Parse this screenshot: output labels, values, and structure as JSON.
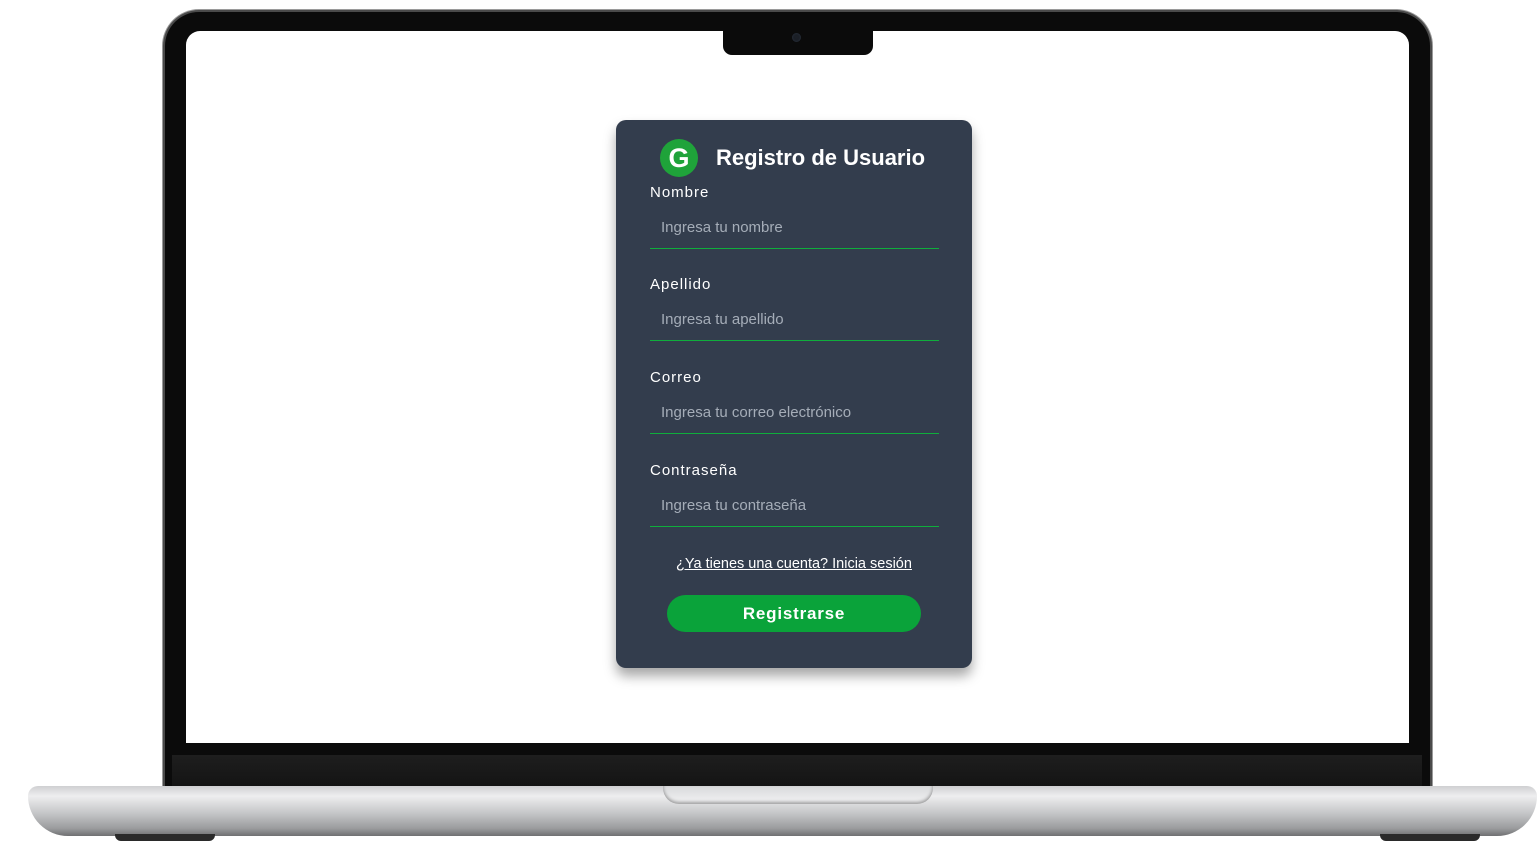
{
  "form": {
    "logo_letter": "G",
    "title": "Registro de Usuario",
    "fields": [
      {
        "label": "Nombre",
        "placeholder": "Ingresa tu nombre",
        "value": ""
      },
      {
        "label": "Apellido",
        "placeholder": "Ingresa tu apellido",
        "value": ""
      },
      {
        "label": "Correo",
        "placeholder": "Ingresa tu correo electrónico",
        "value": ""
      },
      {
        "label": "Contraseña",
        "placeholder": "Ingresa tu contraseña",
        "value": ""
      }
    ],
    "login_link": "¿Ya tienes una cuenta? Inicia sesión",
    "submit_label": "Registrarse"
  },
  "colors": {
    "card_background": "#333d4d",
    "accent_green": "#0aa33a",
    "logo_green": "#1fa33a",
    "placeholder_gray": "#a5adb8"
  }
}
